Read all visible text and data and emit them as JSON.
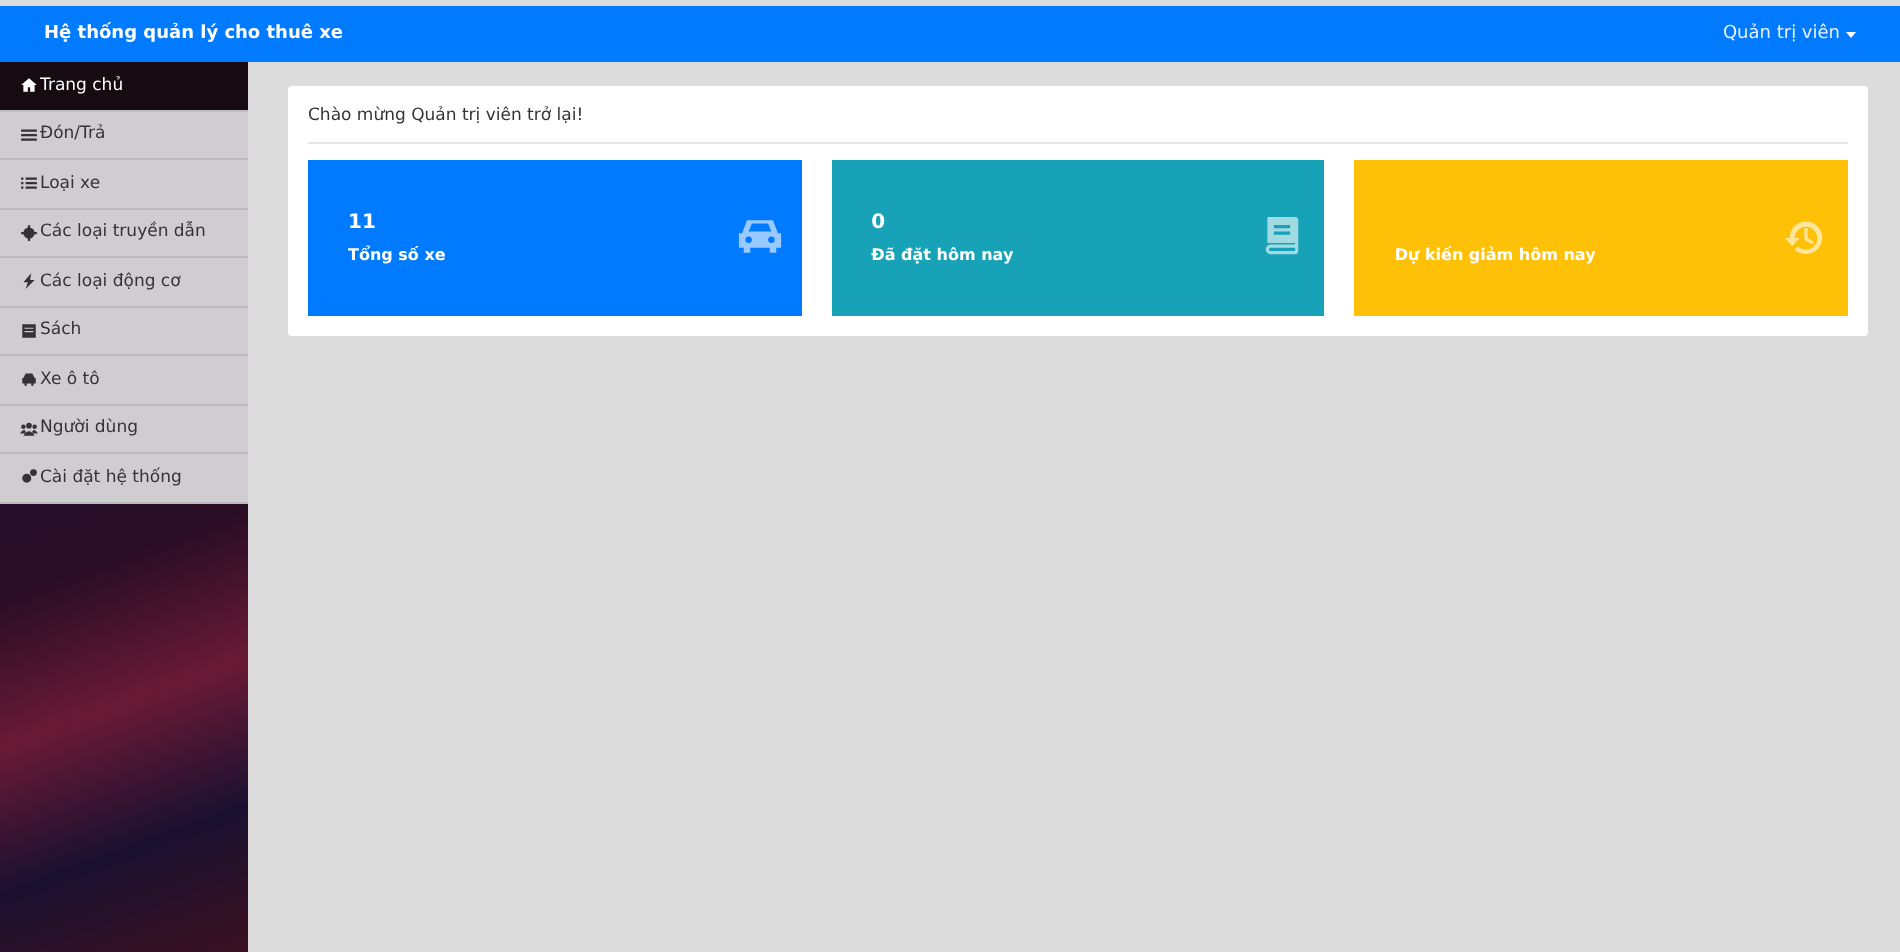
{
  "navbar": {
    "title": "Hệ thống quản lý cho thuê xe",
    "user_menu": "Quản trị viên"
  },
  "sidebar": {
    "items": [
      {
        "label": "Trang chủ",
        "selected": true
      },
      {
        "label": "Đón/Trả",
        "selected": false
      },
      {
        "label": "Loại xe",
        "selected": false
      },
      {
        "label": "Các loại truyền dẫn",
        "selected": false
      },
      {
        "label": "Các loại động cơ",
        "selected": false
      },
      {
        "label": "Sách",
        "selected": false
      },
      {
        "label": "Xe ô tô",
        "selected": false
      },
      {
        "label": "Người dùng",
        "selected": false
      },
      {
        "label": "Cài đặt hệ thống",
        "selected": false
      }
    ]
  },
  "welcome": "Chào mừng Quản trị viên trở lại!",
  "stats": [
    {
      "value": "11",
      "label": "Tổng số xe",
      "color": "#007bff"
    },
    {
      "value": "0",
      "label": "Đã đặt hôm nay",
      "color": "#17a2b8"
    },
    {
      "label": "Dự kiến giảm hôm nay",
      "color": "#ffc107"
    }
  ]
}
